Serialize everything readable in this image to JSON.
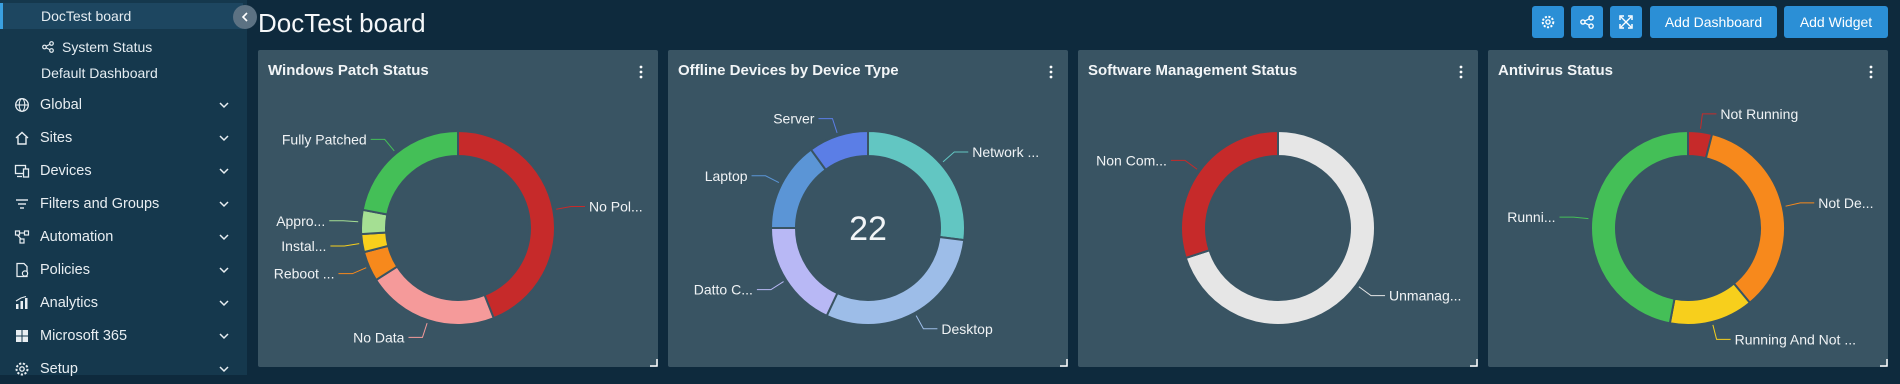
{
  "sidebar": {
    "sub_items": [
      {
        "label": "DocTest board",
        "active": true
      },
      {
        "label": "System Status",
        "icon": "share-nodes-icon"
      },
      {
        "label": "Default Dashboard"
      }
    ],
    "items": [
      {
        "label": "Global",
        "icon": "globe-icon"
      },
      {
        "label": "Sites",
        "icon": "home-icon"
      },
      {
        "label": "Devices",
        "icon": "devices-icon"
      },
      {
        "label": "Filters and Groups",
        "icon": "filter-icon"
      },
      {
        "label": "Automation",
        "icon": "automation-icon"
      },
      {
        "label": "Policies",
        "icon": "policies-icon"
      },
      {
        "label": "Analytics",
        "icon": "analytics-icon"
      },
      {
        "label": "Microsoft 365",
        "icon": "windows-icon"
      },
      {
        "label": "Setup",
        "icon": "gear-icon"
      }
    ]
  },
  "header": {
    "title": "DocTest board",
    "add_dashboard_label": "Add Dashboard",
    "add_widget_label": "Add Widget",
    "icon_buttons": [
      "settings-icon",
      "share-icon",
      "expand-icon"
    ]
  },
  "colors": {
    "accent": "#2b8fd6",
    "widget_bg": "#395463",
    "page_bg": "#0e2a3d",
    "sidebar_bg": "#15384d"
  },
  "widgets": [
    {
      "title": "Windows Patch Status",
      "chart_data": {
        "type": "pie",
        "donut": true,
        "center_label": "",
        "slices": [
          {
            "label": "No Pol...",
            "value": 44,
            "color": "#c62a2a"
          },
          {
            "label": "No Data",
            "value": 22,
            "color": "#f59a9a"
          },
          {
            "label": "Reboot ...",
            "value": 5,
            "color": "#f7891c"
          },
          {
            "label": "Instal...",
            "value": 3,
            "color": "#f7cf1c"
          },
          {
            "label": "Appro...",
            "value": 4,
            "color": "#a5df93"
          },
          {
            "label": "Fully Patched",
            "value": 22,
            "color": "#44bf57"
          }
        ]
      }
    },
    {
      "title": "Offline Devices by Device Type",
      "chart_data": {
        "type": "pie",
        "donut": true,
        "center_label": "22",
        "slices": [
          {
            "label": "Network ...",
            "value": 27,
            "color": "#62c6c2"
          },
          {
            "label": "Desktop",
            "value": 30,
            "color": "#9dbde8"
          },
          {
            "label": "Datto C...",
            "value": 18,
            "color": "#b8b8f5"
          },
          {
            "label": "Laptop",
            "value": 15,
            "color": "#5b95d6"
          },
          {
            "label": "Server",
            "value": 10,
            "color": "#5b7ee6"
          }
        ]
      }
    },
    {
      "title": "Software Management Status",
      "chart_data": {
        "type": "pie",
        "donut": true,
        "center_label": "",
        "slices": [
          {
            "label": "Unmanag...",
            "value": 70,
            "color": "#e6e6e6"
          },
          {
            "label": "Non Com...",
            "value": 30,
            "color": "#c62a2a"
          }
        ]
      }
    },
    {
      "title": "Antivirus Status",
      "chart_data": {
        "type": "pie",
        "donut": true,
        "center_label": "",
        "slices": [
          {
            "label": "Not Running",
            "value": 4,
            "color": "#c62a2a"
          },
          {
            "label": "Not De...",
            "value": 35,
            "color": "#f7891c"
          },
          {
            "label": "Running And Not ...",
            "value": 14,
            "color": "#f7cf1c"
          },
          {
            "label": "Runni...",
            "value": 47,
            "color": "#44bf57"
          }
        ]
      }
    }
  ]
}
